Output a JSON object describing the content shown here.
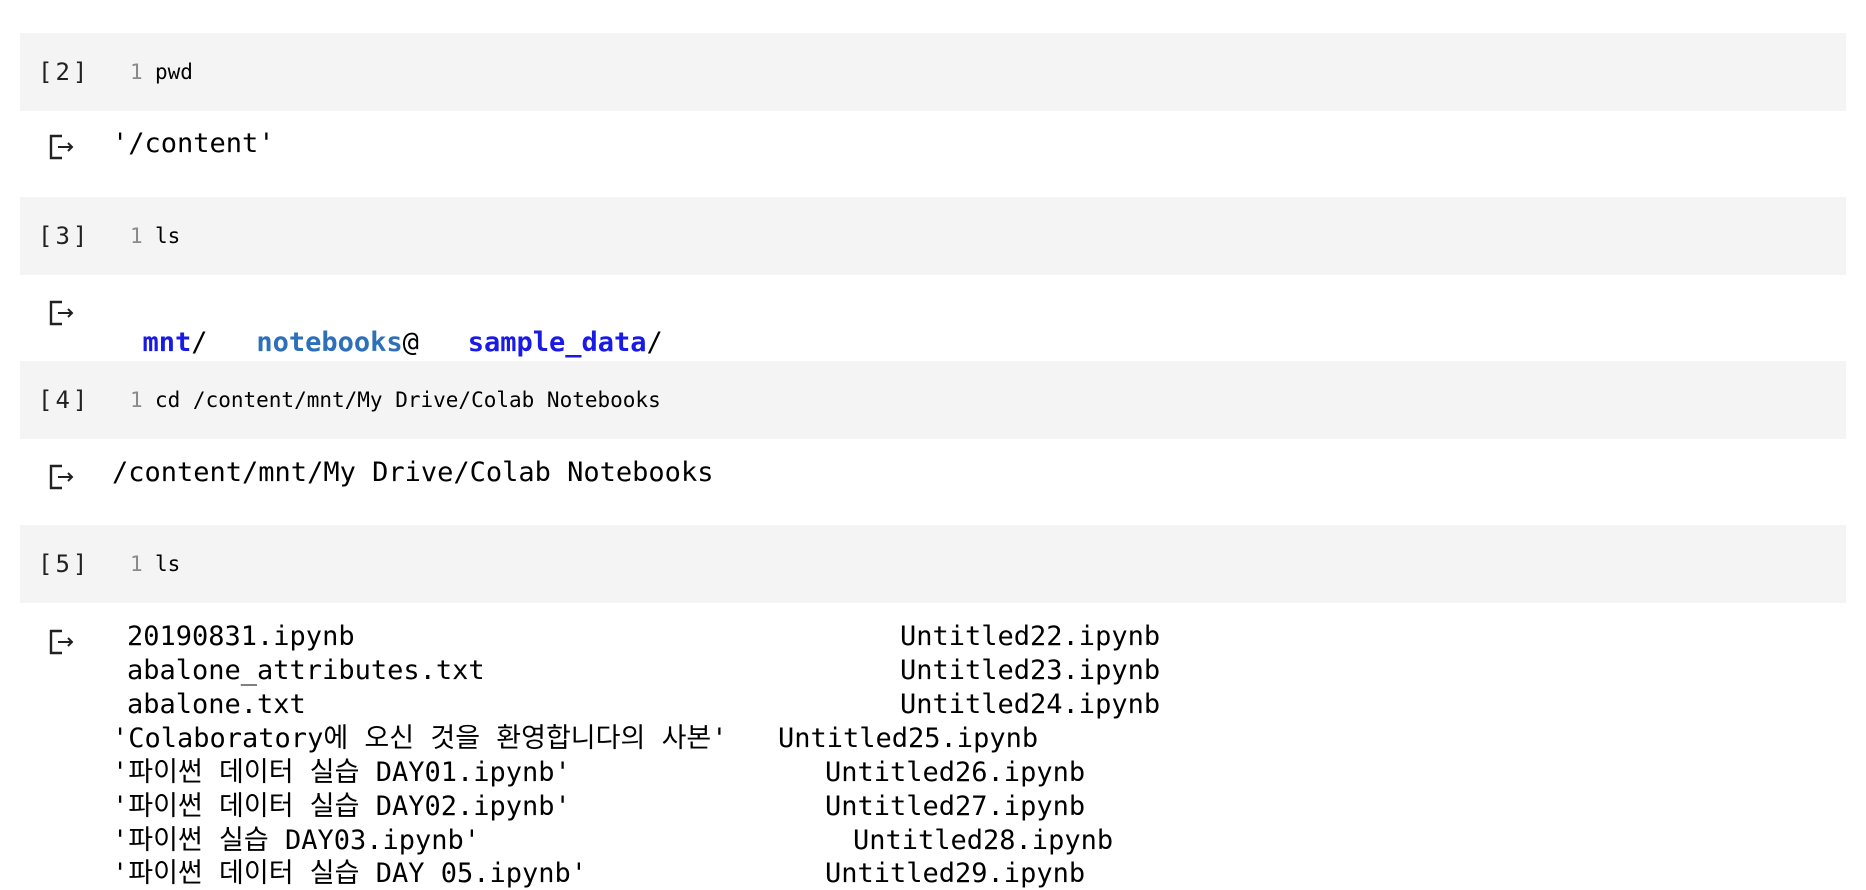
{
  "cells": [
    {
      "prompt": "[2]",
      "line": "1",
      "code": "pwd"
    },
    {
      "prompt": "[3]",
      "line": "1",
      "code": "ls"
    },
    {
      "prompt": "[4]",
      "line": "1",
      "code": "cd /content/mnt/My Drive/Colab Notebooks"
    },
    {
      "prompt": "[5]",
      "line": "1",
      "code": "ls"
    }
  ],
  "outputs": {
    "pwd": "'/content'",
    "ls_root": {
      "mnt": "mnt",
      "mnt_sep": "/",
      "notebooks": "notebooks",
      "notebooks_sep": "@",
      "sample_data": "sample_data",
      "sample_data_sep": "/"
    },
    "cd": "/content/mnt/My Drive/Colab Notebooks",
    "ls_files": {
      "left": [
        "20190831.ipynb",
        "abalone_attributes.txt",
        "abalone.txt",
        "'Colaboratory에 오신 것을 환영합니다의 사본'",
        "'파이썬 데이터 실습 DAY01.ipynb'",
        "'파이썬 데이터 실습 DAY02.ipynb'",
        "'파이썬 실습 DAY03.ipynb'",
        "'파이썬 데이터 실습 DAY 05.ipynb'"
      ],
      "right": [
        "Untitled22.ipynb",
        "Untitled23.ipynb",
        "Untitled24.ipynb",
        "Untitled25.ipynb",
        "Untitled26.ipynb",
        "Untitled27.ipynb",
        "Untitled28.ipynb",
        "Untitled29.ipynb"
      ]
    }
  },
  "icons": {
    "output": "output-arrow-icon"
  }
}
